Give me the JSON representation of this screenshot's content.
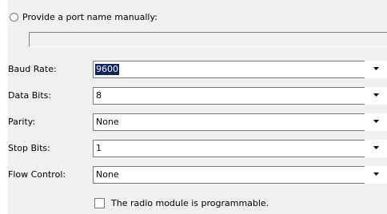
{
  "port_name": {
    "radio_label": "Provide a port name manually:",
    "value": ""
  },
  "fields": [
    {
      "label": "Baud Rate:",
      "value": "9600",
      "selected": true
    },
    {
      "label": "Data Bits:",
      "value": "8",
      "selected": false
    },
    {
      "label": "Parity:",
      "value": "None",
      "selected": false
    },
    {
      "label": "Stop Bits:",
      "value": "1",
      "selected": false
    },
    {
      "label": "Flow Control:",
      "value": "None",
      "selected": false
    }
  ],
  "programmable": {
    "label": "The radio module is programmable.",
    "checked": false
  },
  "icons": {
    "dropdown": "chevron-down-icon"
  },
  "colors": {
    "panel_background": "#f0f0f0",
    "selection_background": "#0a246a",
    "selection_text": "#ffffff"
  }
}
